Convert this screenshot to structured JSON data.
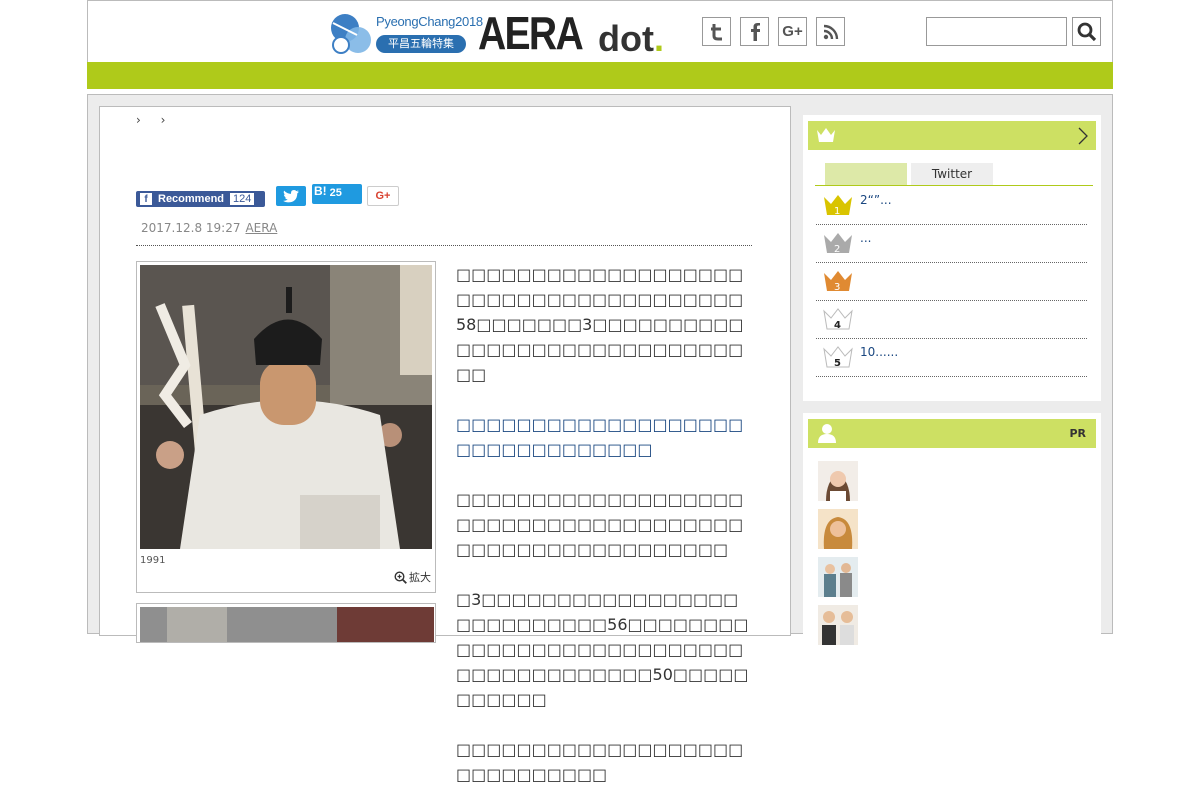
{
  "header": {
    "olympic_title": "PyeongChang2018",
    "olympic_pill": "平昌五輪特集",
    "logo_main": "AERA",
    "logo_dot": "dot",
    "logo_period": ".",
    "social": {
      "twitter": "t",
      "facebook": "f",
      "googleplus": "G+",
      "rss": "rss"
    },
    "search_placeholder": ""
  },
  "colors": {
    "accent": "#afca1a",
    "sidebar_head": "#cde063",
    "link": "#1a4780"
  },
  "article": {
    "breadcrumb": "› ›",
    "share": {
      "recommend_label": "Recommend",
      "recommend_count": "124",
      "hatena_label": "B!",
      "hatena_count": "25",
      "gplus_label": "G+"
    },
    "date": "2017.12.8 19:27",
    "source": "AERA",
    "photo_caption": "1991",
    "zoom_label": "拡大",
    "paragraphs": [
      "□□□□□□□□□□□□□□□□□□□□□□□□□□□□□□□□□□□□□□58□□□□□□□3□□□□□□□□□□□□□□□□□□□□□□□□□□□□□□□",
      "□□□□□□□□□□□□□□□□□□□□□□□□□□□□□□□□",
      "□□□□□□□□□□□□□□□□□□□□□□□□□□□□□□□□□□□□□□□□□□□□□□□□□□□□□□□□",
      "□3□□□□□□□□□□□□□□□□□□□□□□□□□□□56□□□□□□□□□□□□□□□□□□□□□□□□□□□□□□□□□□□□□□□□50□□□□□□□□□□□",
      "□□□□□□□□□□□□□□□□□□□□□□□□□□□□□"
    ]
  },
  "ranking": {
    "tab_active": "",
    "tab_twitter": "Twitter",
    "items": [
      {
        "rank": "1",
        "text": "2“”..."
      },
      {
        "rank": "2",
        "text": "..."
      },
      {
        "rank": "3",
        "text": ""
      },
      {
        "rank": "4",
        "text": ""
      },
      {
        "rank": "5",
        "text": "10......"
      }
    ]
  },
  "pr_section": {
    "label": "PR"
  }
}
